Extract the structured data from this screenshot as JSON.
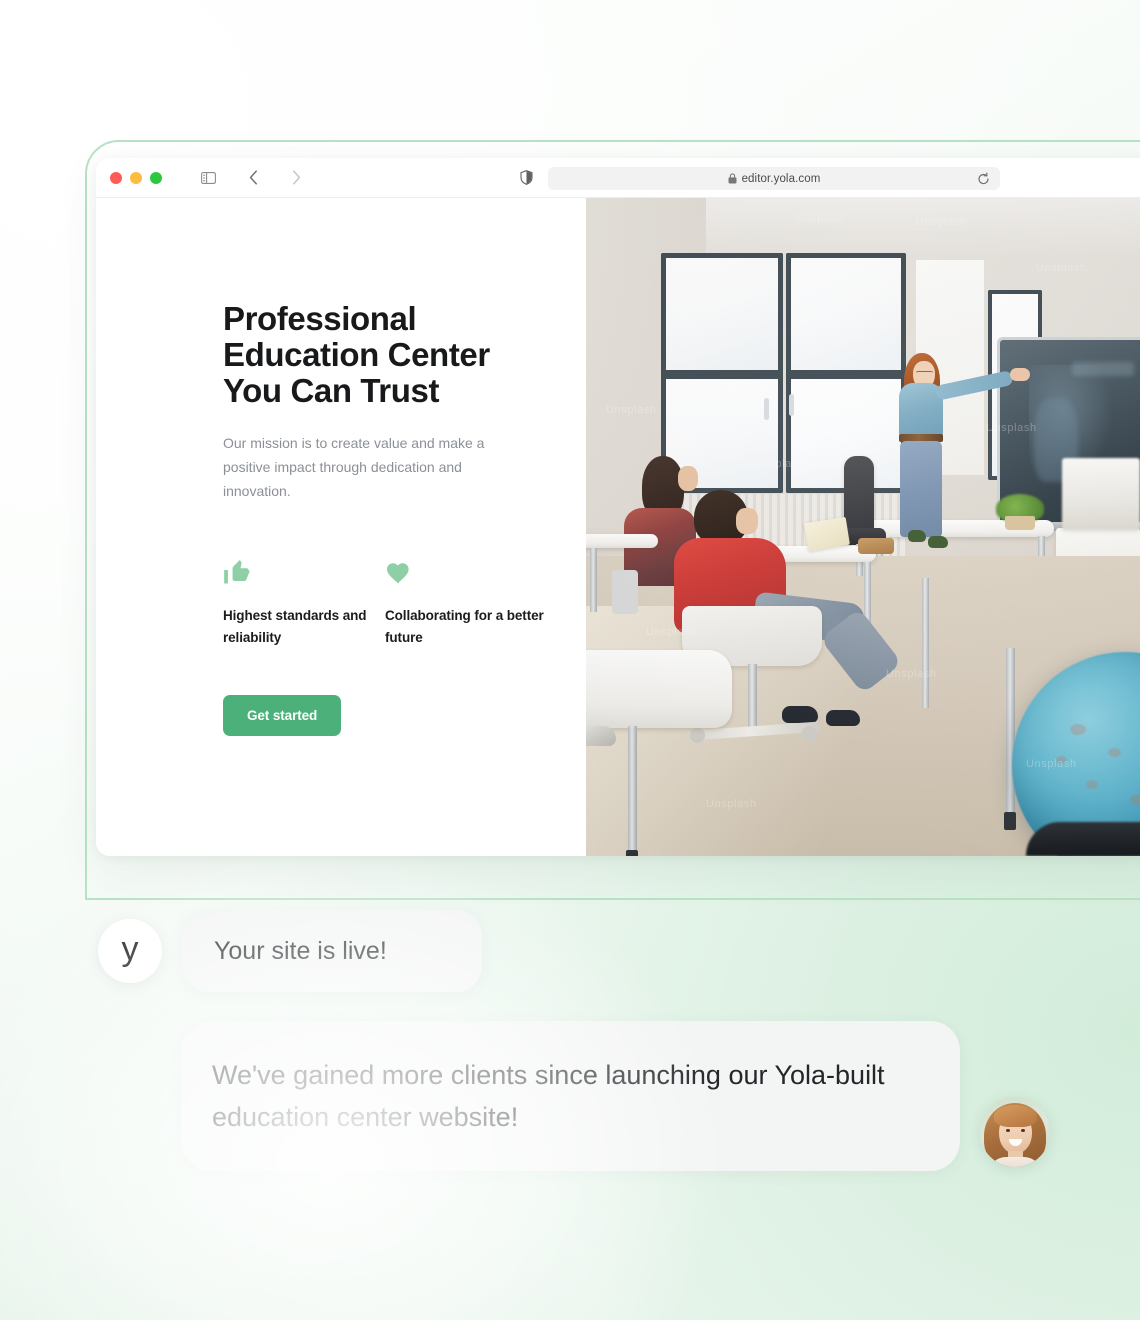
{
  "browser": {
    "traffic_lights": [
      "close",
      "minimize",
      "maximize"
    ],
    "sidebar_icon": "sidebar-toggle-icon",
    "back_label": "‹",
    "forward_label": "›",
    "shield_icon": "privacy-shield-icon",
    "lock_icon": "lock-icon",
    "url": "editor.yola.com",
    "reload_icon": "reload-icon"
  },
  "site": {
    "hero": {
      "title": "Professional Education Center You Can Trust",
      "subtitle": "Our mission is to create value and make a positive impact through dedication and innovation.",
      "cta_label": "Get started",
      "features": [
        {
          "icon": "thumbs-up-icon",
          "label": "Highest standards and reliability"
        },
        {
          "icon": "heart-icon",
          "label": "Collaborating for a better future"
        }
      ]
    },
    "photo": {
      "alt": "classroom-photo",
      "watermark": "Unsplash"
    }
  },
  "chat": {
    "logo_letter": "y",
    "message_1": "Your site is live!",
    "message_2": "We've gained more clients since launching our Yola-built education center website!",
    "avatar": "customer-avatar"
  },
  "colors": {
    "brand_green": "#4bb07a",
    "icon_green": "#8ecfa6",
    "frame_green": "#b7e3c4",
    "bubble_gray": "#f3f5f4",
    "text_dark": "#18191b",
    "text_muted": "#8b9096"
  }
}
